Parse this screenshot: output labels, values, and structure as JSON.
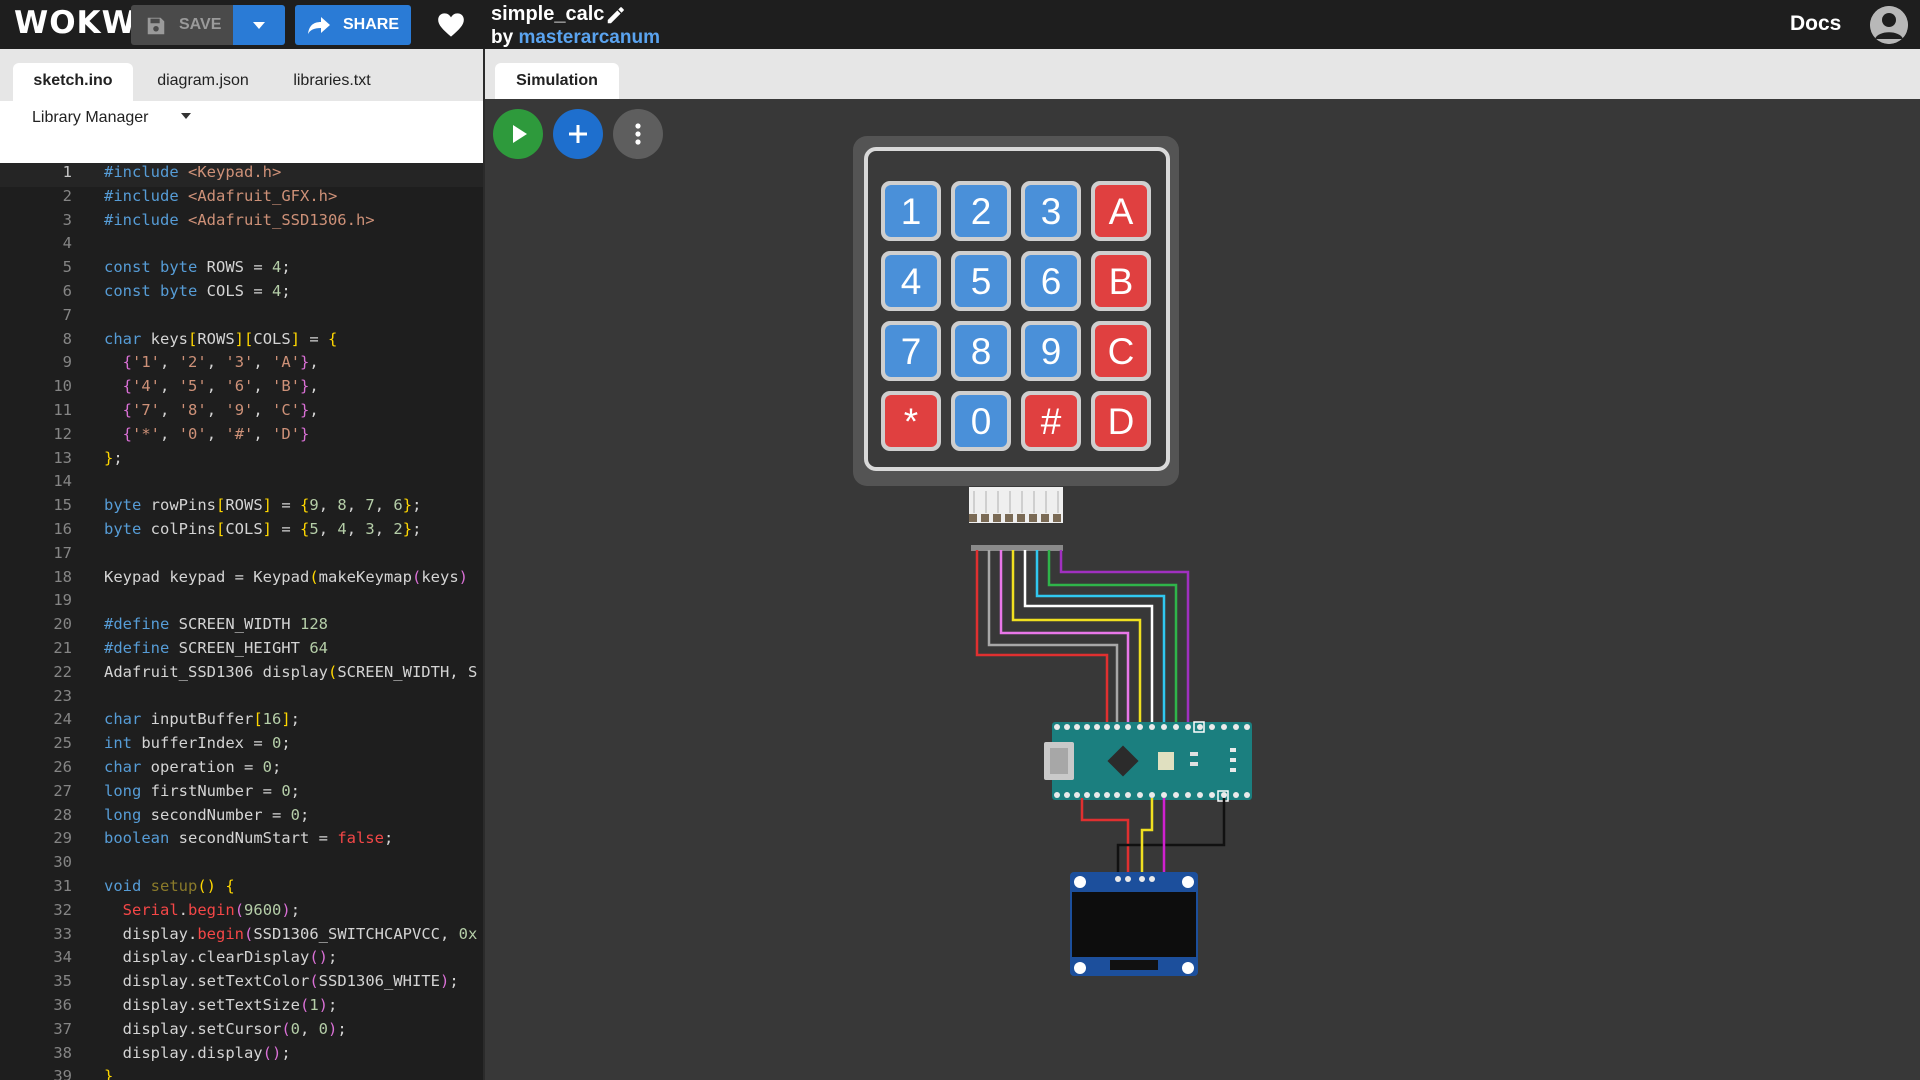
{
  "topbar": {
    "logo": "WOKWi",
    "save_label": "SAVE",
    "share_label": "SHARE",
    "project_title": "simple_calc",
    "by_prefix": "by ",
    "author": "masterarcanum",
    "docs_label": "Docs"
  },
  "editor": {
    "tabs": [
      {
        "label": "sketch.ino",
        "active": true
      },
      {
        "label": "diagram.json",
        "active": false
      },
      {
        "label": "libraries.txt",
        "active": false
      }
    ],
    "library_manager_label": "Library Manager",
    "current_line": 1
  },
  "simulation": {
    "tab_label": "Simulation",
    "keypad_keys": [
      [
        "1",
        "2",
        "3",
        "A"
      ],
      [
        "4",
        "5",
        "6",
        "B"
      ],
      [
        "7",
        "8",
        "9",
        "C"
      ],
      [
        "*",
        "0",
        "#",
        "D"
      ]
    ]
  },
  "icons": {
    "save": "floppy-disk-icon",
    "dropdown": "caret-down-icon",
    "share": "share-arrow-icon",
    "like": "heart-icon",
    "edit": "pencil-icon",
    "account": "user-circle-icon",
    "play": "play-icon",
    "add": "plus-icon",
    "more": "more-vertical-icon"
  },
  "colors": {
    "primary_blue": "#2a7bd6",
    "play_green": "#2e9a3c",
    "keypad_blue_key": "#4a90d9",
    "keypad_red_key": "#e04040",
    "arduino_teal": "#1b7f7f"
  }
}
